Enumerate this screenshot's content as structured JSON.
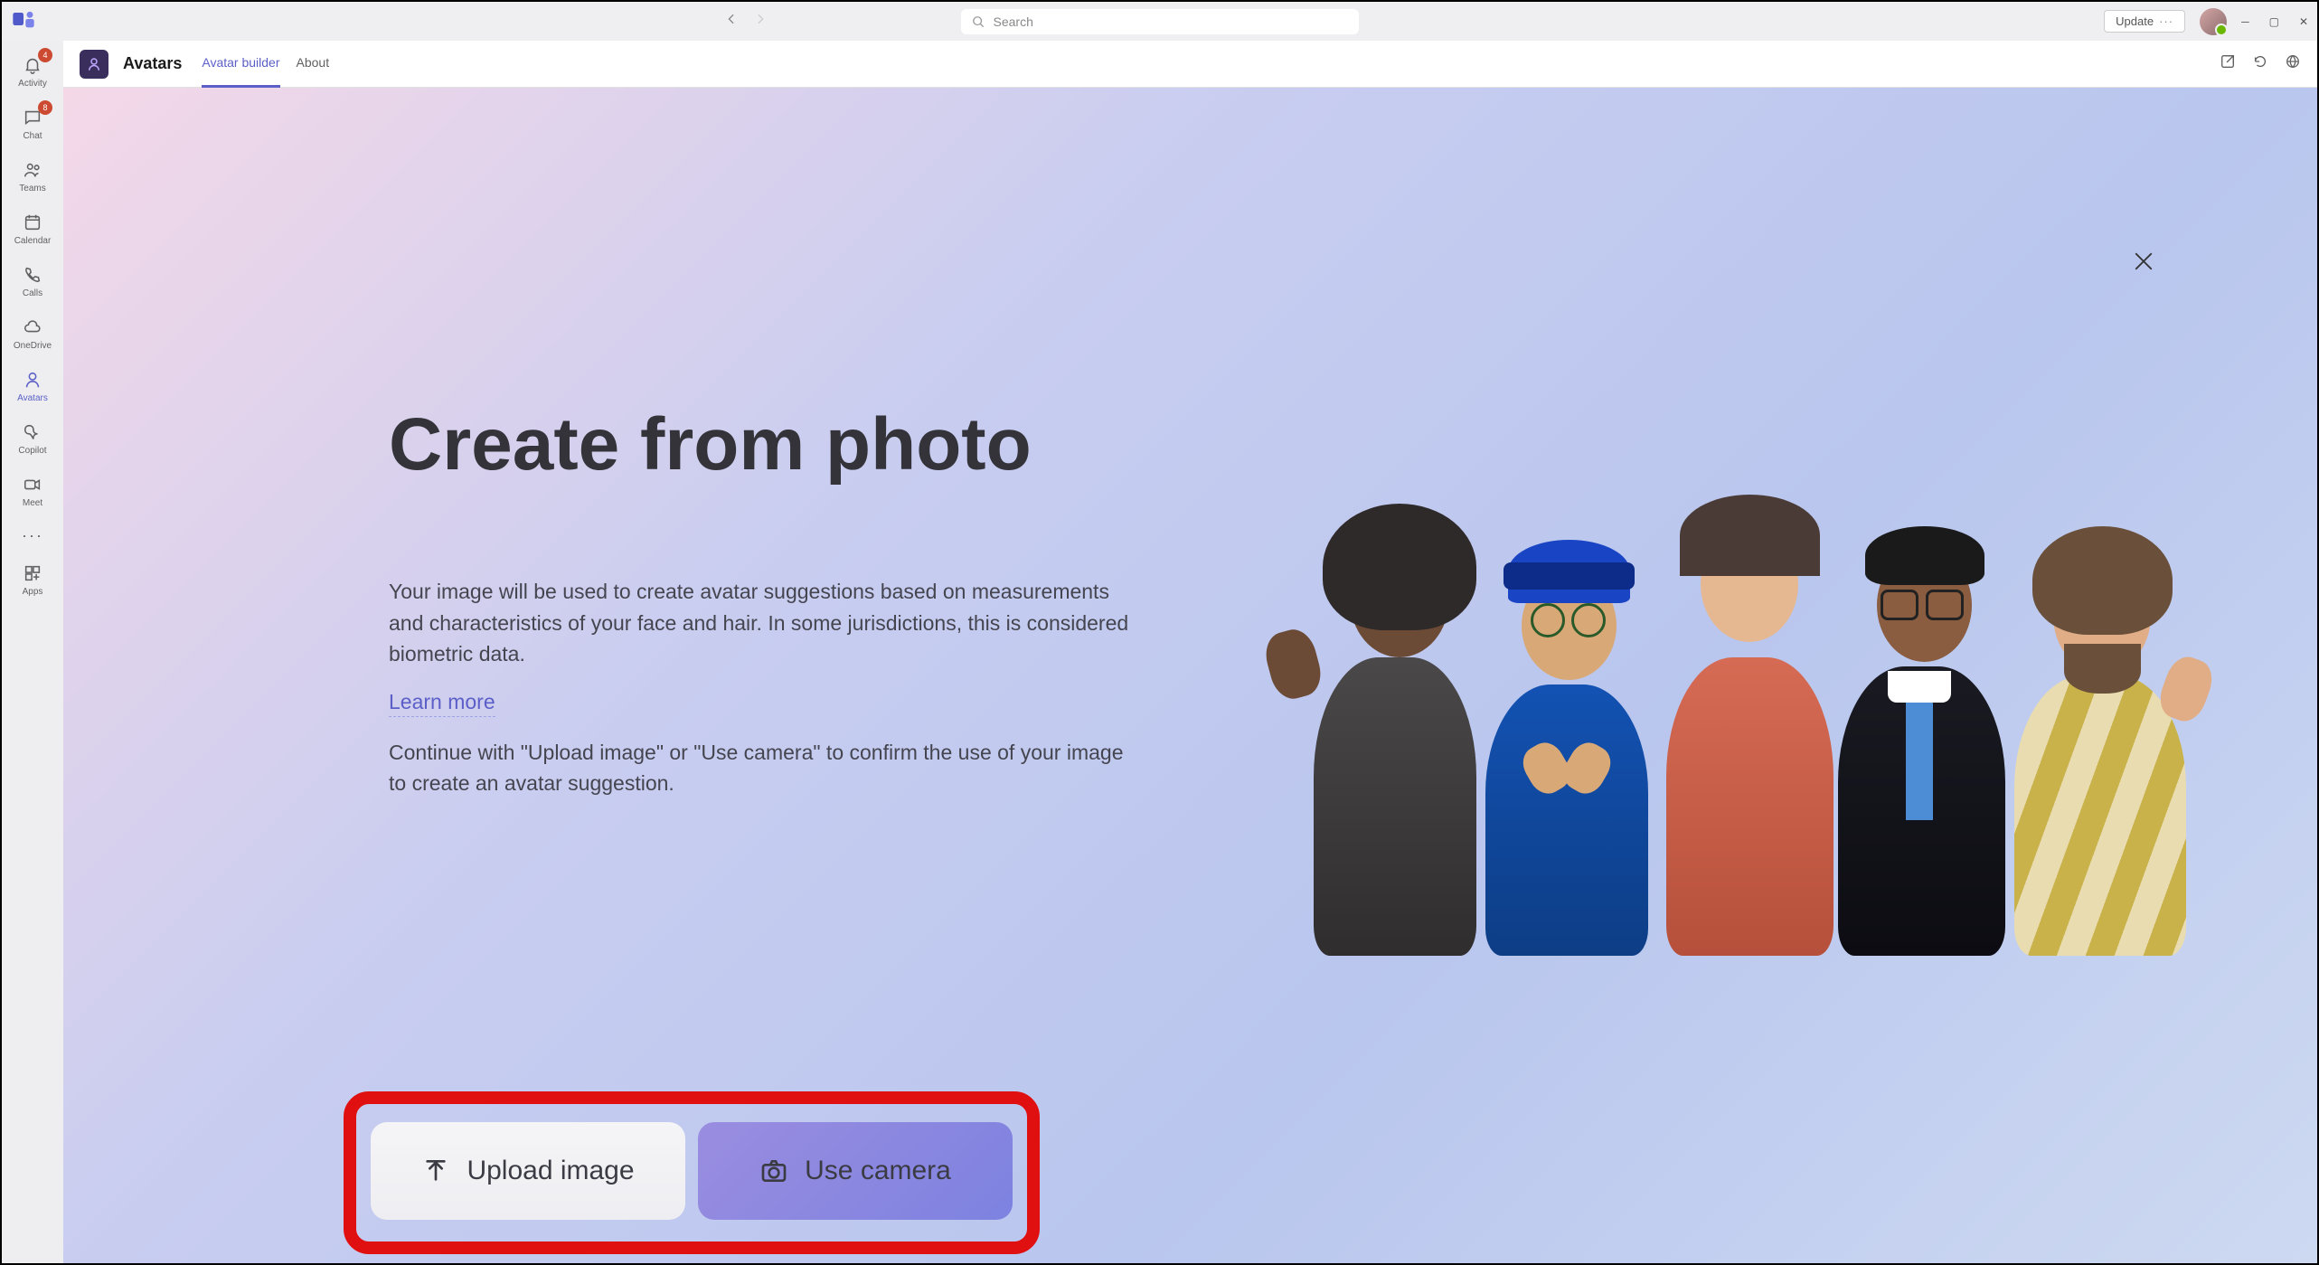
{
  "titlebar": {
    "search_placeholder": "Search",
    "update_label": "Update"
  },
  "leftrail": {
    "items": [
      {
        "label": "Activity",
        "badge": "4"
      },
      {
        "label": "Chat",
        "badge": "8"
      },
      {
        "label": "Teams",
        "badge": ""
      },
      {
        "label": "Calendar",
        "badge": ""
      },
      {
        "label": "Calls",
        "badge": ""
      },
      {
        "label": "OneDrive",
        "badge": ""
      },
      {
        "label": "Avatars",
        "badge": ""
      },
      {
        "label": "Copilot",
        "badge": ""
      },
      {
        "label": "Meet",
        "badge": ""
      }
    ],
    "apps_label": "Apps"
  },
  "subheader": {
    "app_name": "Avatars",
    "tabs": [
      {
        "label": "Avatar builder"
      },
      {
        "label": "About"
      }
    ]
  },
  "content": {
    "headline": "Create from photo",
    "para1": "Your image will be used to create avatar suggestions based on measurements and characteristics of your face and hair. In some jurisdictions, this is considered biometric data.",
    "learn_more": "Learn more",
    "para2": "Continue with \"Upload image\" or \"Use camera\" to confirm the use of your image to create an avatar suggestion.",
    "upload_label": "Upload image",
    "camera_label": "Use camera"
  }
}
